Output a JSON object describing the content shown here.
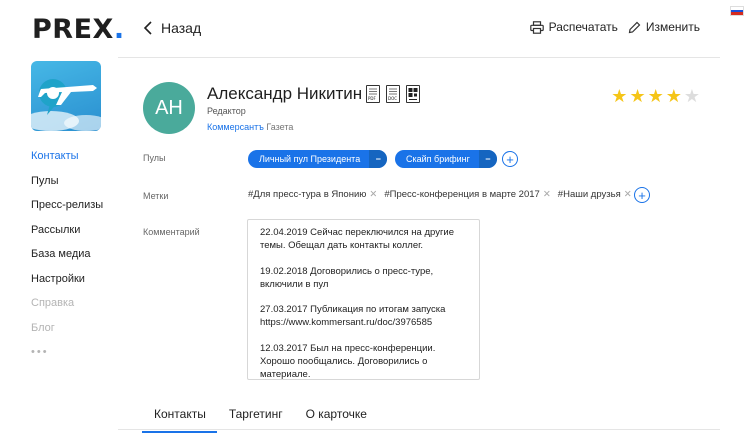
{
  "brand": {
    "logo_text": "PREX",
    "logo_dot": ".",
    "accent": "#1a73e8"
  },
  "header": {
    "back_label": "Назад",
    "print_label": "Распечатать",
    "edit_label": "Изменить"
  },
  "sidebar": {
    "items": [
      {
        "label": "Контакты",
        "state": "active"
      },
      {
        "label": "Пулы",
        "state": "normal"
      },
      {
        "label": "Пресс-релизы",
        "state": "normal"
      },
      {
        "label": "Рассылки",
        "state": "normal"
      },
      {
        "label": "База медиа",
        "state": "normal"
      },
      {
        "label": "Настройки",
        "state": "normal"
      },
      {
        "label": "Справка",
        "state": "disabled"
      },
      {
        "label": "Блог",
        "state": "disabled"
      }
    ],
    "more": "•••"
  },
  "contact": {
    "initials": "АН",
    "avatar_color": "#4aaa9b",
    "name": "Александр Никитин",
    "role": "Редактор",
    "publication": "Коммерсантъ",
    "publication_type": "Газета",
    "rating": 4,
    "rating_max": 5,
    "doc_icons": [
      "pdf-icon",
      "doc-icon",
      "qr-icon"
    ]
  },
  "fields": {
    "pools_label": "Пулы",
    "tags_label": "Метки",
    "comment_label": "Комментарий"
  },
  "pools": [
    "Личный пул Президента",
    "Скайп брифинг"
  ],
  "tags": [
    "#Для пресс-тура в Японию",
    "#Пресс-конференция в марте 2017",
    "#Наши друзья"
  ],
  "comments": [
    "22.04.2019 Сейчас переключился на другие темы. Обещал дать контакты коллег.",
    "19.02.2018 Договорились о пресс-туре, включили в пул",
    "27.03.2017 Публикация по итогам запуска https://www.kommersant.ru/doc/3976585",
    "12.03.2017 Был на пресс-конференции. Хорошо пообщались. Договорились о материале."
  ],
  "tabs": [
    {
      "label": "Контакты",
      "active": true
    },
    {
      "label": "Таргетинг",
      "active": false
    },
    {
      "label": "О карточке",
      "active": false
    }
  ],
  "language_flag": "ru-flag-icon"
}
